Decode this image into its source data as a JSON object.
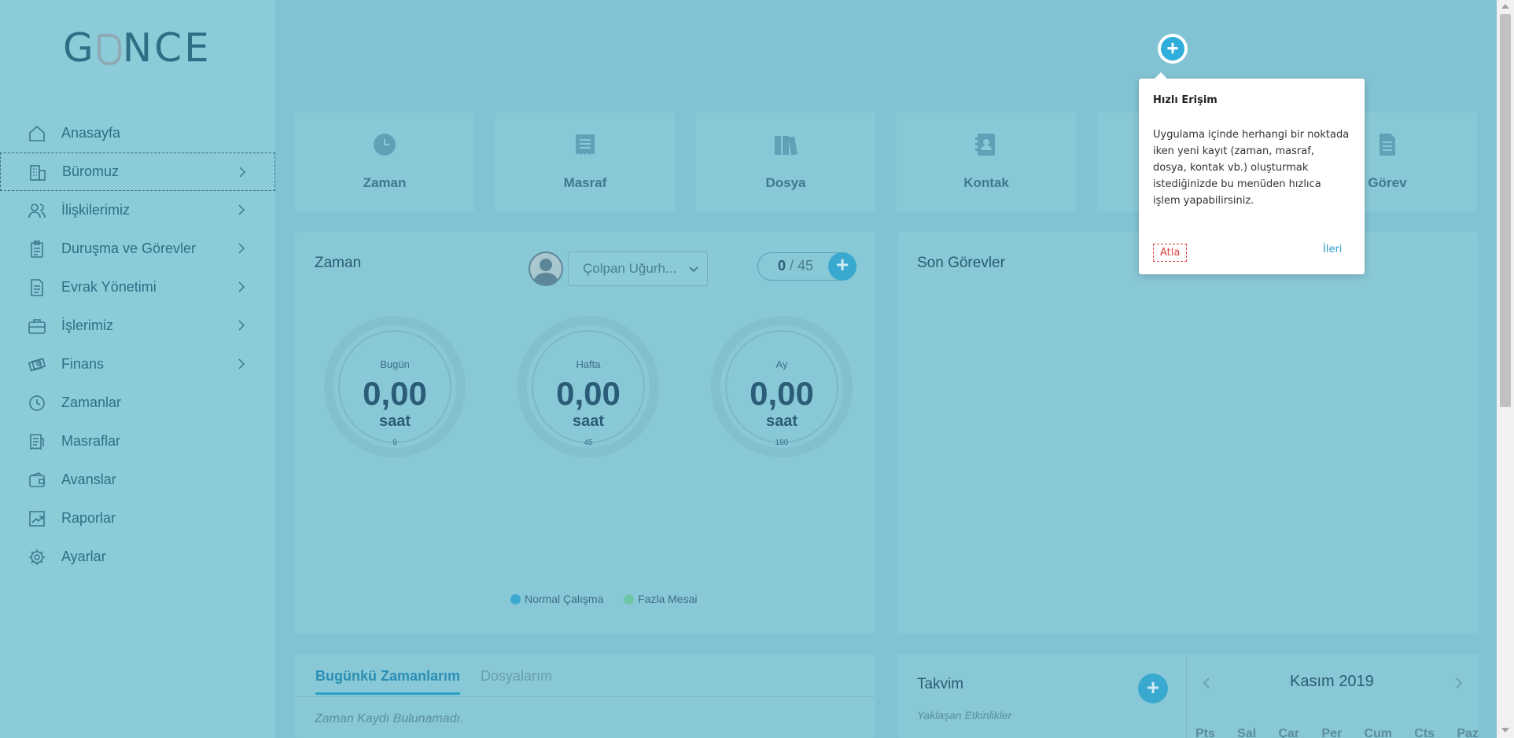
{
  "logo": {
    "part1": "G",
    "part2": "NCE"
  },
  "sidebar": {
    "items": [
      {
        "label": "Anasayfa",
        "icon": "home-icon",
        "has_chevron": false
      },
      {
        "label": "Büromuz",
        "icon": "building-icon",
        "has_chevron": true,
        "active": true
      },
      {
        "label": "İlişkilerimiz",
        "icon": "users-icon",
        "has_chevron": true
      },
      {
        "label": "Duruşma ve Görevler",
        "icon": "clipboard-icon",
        "has_chevron": true
      },
      {
        "label": "Evrak Yönetimi",
        "icon": "document-icon",
        "has_chevron": true
      },
      {
        "label": "İşlerimiz",
        "icon": "briefcase-icon",
        "has_chevron": true
      },
      {
        "label": "Finans",
        "icon": "money-icon",
        "has_chevron": true
      },
      {
        "label": "Zamanlar",
        "icon": "clock-icon",
        "has_chevron": false
      },
      {
        "label": "Masraflar",
        "icon": "receipt-icon",
        "has_chevron": false
      },
      {
        "label": "Avanslar",
        "icon": "wallet-icon",
        "has_chevron": false
      },
      {
        "label": "Raporlar",
        "icon": "chart-icon",
        "has_chevron": false
      },
      {
        "label": "Ayarlar",
        "icon": "gear-icon",
        "has_chevron": false
      }
    ]
  },
  "quick_cards": [
    {
      "label": "Zaman",
      "icon": "clock-icon"
    },
    {
      "label": "Masraf",
      "icon": "receipt-icon"
    },
    {
      "label": "Dosya",
      "icon": "books-icon"
    },
    {
      "label": "Kontak",
      "icon": "contact-book-icon"
    },
    {
      "label": "",
      "icon": ""
    },
    {
      "label": "Görev",
      "icon": "task-document-icon"
    }
  ],
  "zaman_card": {
    "title": "Zaman",
    "user_select": "Çolpan Uğurh...",
    "counter_current": "0",
    "counter_sep": " / ",
    "counter_total": "45",
    "gauges": [
      {
        "label": "Bugün",
        "value": "0,00",
        "unit": "saat",
        "target": "9"
      },
      {
        "label": "Hafta",
        "value": "0,00",
        "unit": "saat",
        "target": "45"
      },
      {
        "label": "Ay",
        "value": "0,00",
        "unit": "saat",
        "target": "180"
      }
    ],
    "legend": [
      {
        "label": "Normal Çalışma",
        "color": "#3aa9cf"
      },
      {
        "label": "Fazla Mesai",
        "color": "#6dc6a6"
      }
    ]
  },
  "son_gorevler": {
    "title": "Son Görevler"
  },
  "bottom_tabs": {
    "active": "Bugünkü Zamanlarım",
    "inactive": "Dosyalarım",
    "empty": "Zaman Kaydı Bulunamadı."
  },
  "takvim": {
    "title": "Takvim",
    "subtitle": "Yaklaşan Etkinlikler",
    "month": "Kasım 2019",
    "weekdays": [
      "Pts",
      "Sal",
      "Çar",
      "Per",
      "Cum",
      "Cts",
      "Paz"
    ]
  },
  "popup": {
    "title": "Hızlı Erişim",
    "body": "Uygulama içinde herhangi bir noktada iken yeni kayıt (zaman, masraf, dosya, kontak vb.) oluşturmak istediğinizde bu menüden hızlıca işlem yapabilirsiniz.",
    "skip": "Atla",
    "next": "İleri"
  },
  "colors": {
    "accent": "#2faedc",
    "overlay": "#82c3d3",
    "danger": "#e04040"
  }
}
